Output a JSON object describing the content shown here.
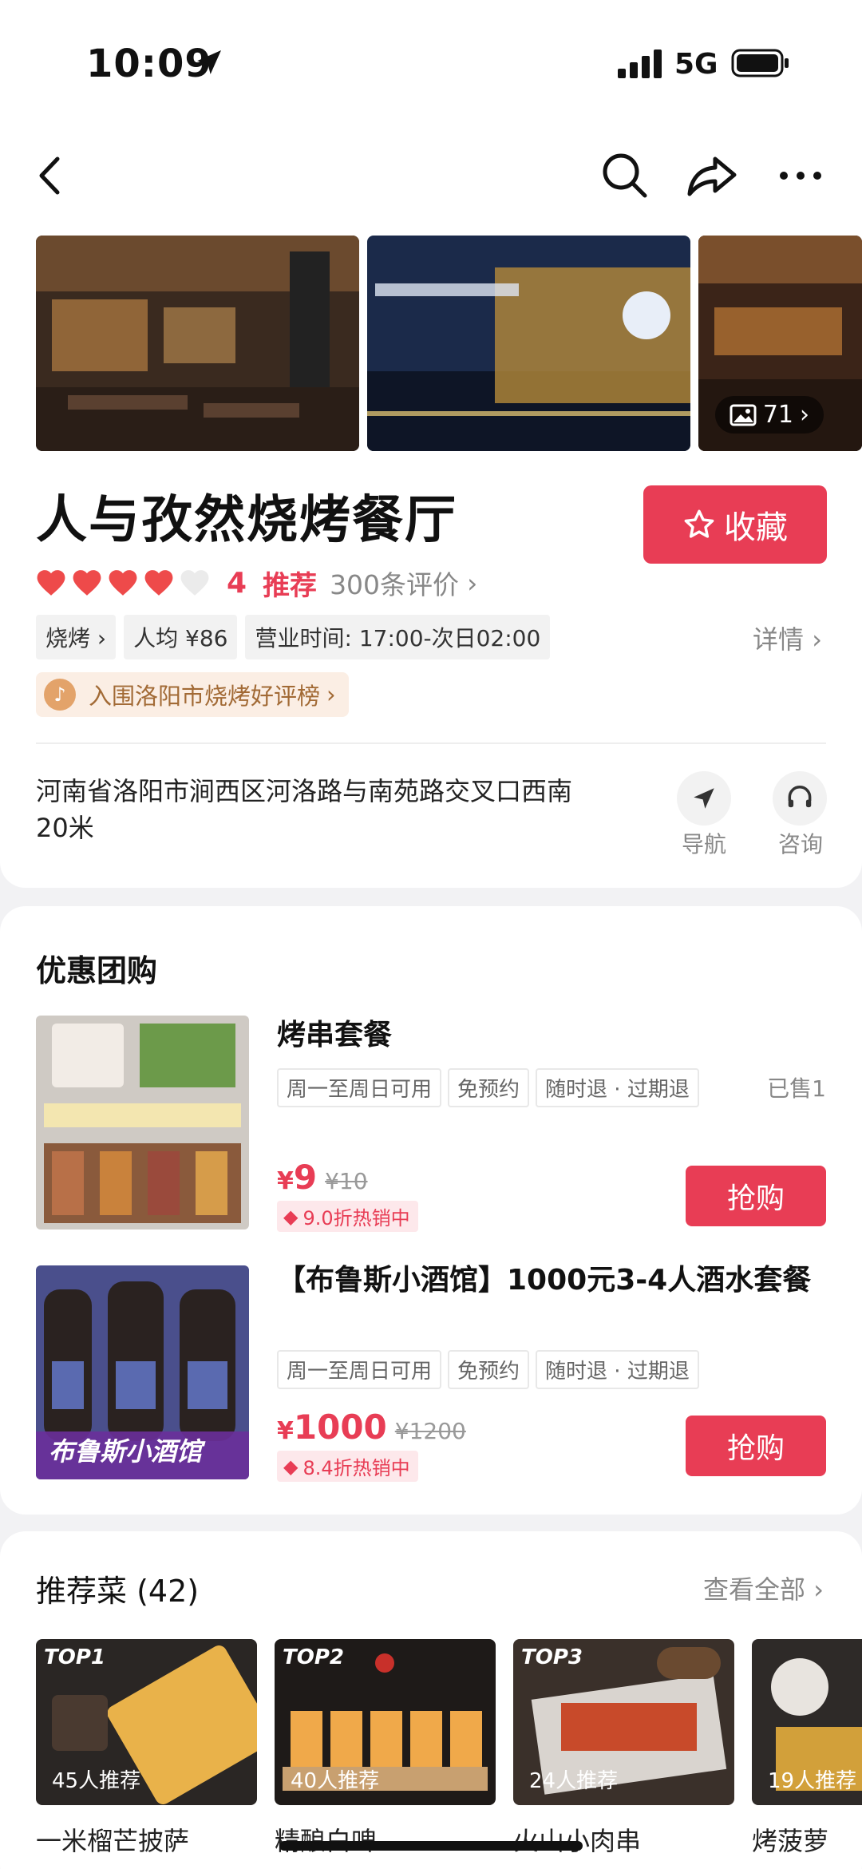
{
  "status_bar": {
    "time": "10:09",
    "network": "5G"
  },
  "gallery": {
    "photo_count": "71"
  },
  "shop": {
    "name": "人与孜然烧烤餐厅",
    "favorite_label": "收藏",
    "rating_hearts": 4,
    "score": "4",
    "recommend_label": "推荐",
    "reviews": "300条评价",
    "tags": [
      "烧烤",
      "人均 ¥86",
      "营业时间: 17:00-次日02:00"
    ],
    "detail_label": "详情",
    "rank_badge": "入围洛阳市烧烤好评榜",
    "address": "河南省洛阳市涧西区河洛路与南苑路交叉口西南20米",
    "nav_label": "导航",
    "consult_label": "咨询"
  },
  "deals": {
    "title": "优惠团购",
    "items": [
      {
        "title": "烤串套餐",
        "tags": [
          "周一至周日可用",
          "免预约",
          "随时退 · 过期退"
        ],
        "sold": "已售1",
        "yen": "¥",
        "price": "9",
        "original": "¥10",
        "promo": "9.0折热销中",
        "buy": "抢购"
      },
      {
        "title": "【布鲁斯小酒馆】1000元3-4人酒水套餐",
        "tags": [
          "周一至周日可用",
          "免预约",
          "随时退 · 过期退"
        ],
        "yen": "¥",
        "price": "1000",
        "original": "¥1200",
        "promo": "8.4折热销中",
        "buy": "抢购",
        "image_caption": "布鲁斯小酒馆"
      }
    ]
  },
  "dishes": {
    "title": "推荐菜 (42)",
    "see_all": "查看全部",
    "items": [
      {
        "rank": "TOP1",
        "recommend": "45人推荐",
        "name": "一米榴芒披萨"
      },
      {
        "rank": "TOP2",
        "recommend": "40人推荐",
        "name": "精酿白啤"
      },
      {
        "rank": "TOP3",
        "recommend": "24人推荐",
        "name": "火山小肉串"
      },
      {
        "rank": "",
        "recommend": "19人推荐",
        "name": "烤菠萝"
      }
    ]
  }
}
